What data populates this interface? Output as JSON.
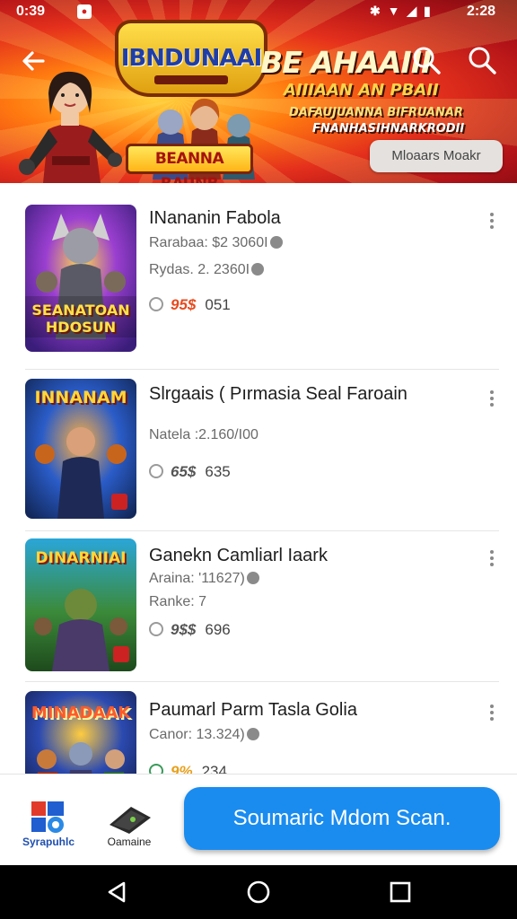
{
  "status_bar": {
    "time_left": "0:39",
    "time_right": "2:28",
    "notification_icon": "app-notification-icon",
    "system_icons": [
      "bluetooth-icon",
      "wifi-icon",
      "signal-icon",
      "battery-icon"
    ]
  },
  "banner": {
    "back_icon": "arrow-left-icon",
    "search_icons": [
      "search-icon",
      "search-icon"
    ],
    "emblem_text": "IBNDUNAAI",
    "ribbon_text": "BEANNA RAUNB",
    "headline_1": "BE AHAAIII",
    "headline_2": "AIIIAAN AN PBAII",
    "headline_3": "DAFAUJUANNA BIFRUANAR",
    "headline_4": "FNANHASIHNARKRODII",
    "chip_label": "Mloaars Moakr",
    "colors": {
      "red": "#e4301c",
      "gold": "#ffcf3a"
    }
  },
  "items": [
    {
      "title": "INananin Fabola",
      "meta": [
        "Rarabaa: $2 3060I",
        "Rydas. 2. 2360I"
      ],
      "score_icon": "comment-icon",
      "score_badge": "95$",
      "score_value": "051",
      "thumb_title": "SEANATOAN HDOSUN"
    },
    {
      "title": "Slrgaais ( Pırmasia Seal Faroain",
      "meta": [
        "Natela :2.160/I00"
      ],
      "score_icon": "comment-icon",
      "score_badge": "65$",
      "score_value": "635",
      "thumb_title": "INNANAM"
    },
    {
      "title": "Ganekn Camliarl Iaark",
      "meta": [
        "Araina: '11627)",
        "Ranke: 7"
      ],
      "score_icon": "comment-icon",
      "score_badge": "9$$",
      "score_value": "696",
      "thumb_title": "DINARNIAI"
    },
    {
      "title": "Paumarl Parm Tasla Golia",
      "meta": [
        "Canor: 13.324)"
      ],
      "score_icon": "comment-icon",
      "score_badge": "9%",
      "score_value": "234",
      "thumb_title": "MINADAAK"
    }
  ],
  "bottom_nav": {
    "items": [
      {
        "label": "Syrapuhlc",
        "icon": "app-grid-icon"
      },
      {
        "label": "Oamaine",
        "icon": "game-device-icon"
      }
    ],
    "cta_label": "Soumaric Mdom Scan."
  },
  "system_nav": {
    "icons": [
      "back-triangle-icon",
      "home-circle-icon",
      "recents-square-icon"
    ]
  }
}
